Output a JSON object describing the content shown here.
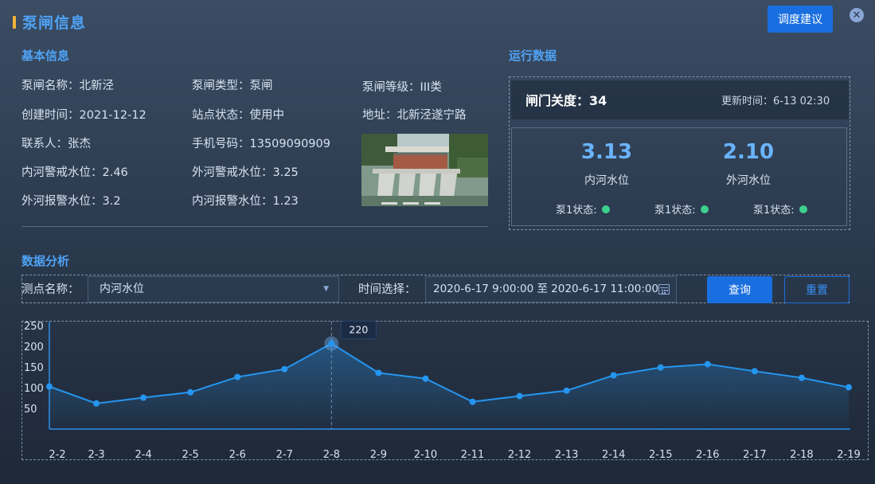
{
  "header": {
    "title": "泵闸信息",
    "advise_button": "调度建议",
    "close_symbol": "✕"
  },
  "basic": {
    "heading": "基本信息",
    "name": "泵闸名称：北新泾",
    "type": "泵闸类型：泵闸",
    "grade": "泵闸等级：III类",
    "created": "创建时间：2021-12-12",
    "status": "站点状态：使用中",
    "address": "地址：北新泾遂宁路",
    "contact": "联系人：张杰",
    "phone": "手机号码：13509090909",
    "inner_warn": "内河警戒水位：2.46",
    "outer_warn": "外河警戒水位：3.25",
    "outer_alarm": "外河报警水位：3.2",
    "inner_alarm": "内河报警水位：1.23"
  },
  "running": {
    "heading": "运行数据",
    "gate_open": "闸门关度：34",
    "update_time": "更新时间：6-13 02:30",
    "inner_value": "3.13",
    "inner_label": "内河水位",
    "outer_value": "2.10",
    "outer_label": "外河水位",
    "pumps": [
      "泵1状态:",
      "泵1状态:",
      "泵1状态:"
    ],
    "pump_status_color": "#3ccf8e"
  },
  "analysis": {
    "heading": "数据分析",
    "point_label": "测点名称：",
    "point_value": "内河水位",
    "time_label": "时间选择：",
    "time_value": "2020-6-17 9:00:00 至 2020-6-17 11:00:00",
    "query_button": "查询",
    "reset_button": "重置"
  },
  "chart_data": {
    "type": "line",
    "categories": [
      "2-2",
      "2-3",
      "2-4",
      "2-5",
      "2-6",
      "2-7",
      "2-8",
      "2-9",
      "2-10",
      "2-11",
      "2-12",
      "2-13",
      "2-14",
      "2-15",
      "2-16",
      "2-17",
      "2-18",
      "2-19"
    ],
    "values": [
      103,
      62,
      76,
      89,
      126,
      145,
      207,
      136,
      122,
      66,
      80,
      93,
      130,
      149,
      157,
      140,
      124,
      101
    ],
    "yticks": [
      50,
      100,
      150,
      200,
      250
    ],
    "ylim": [
      0,
      260
    ],
    "highlight_index": 6,
    "tooltip": "220",
    "line_color": "#2596f0",
    "grid": false
  }
}
